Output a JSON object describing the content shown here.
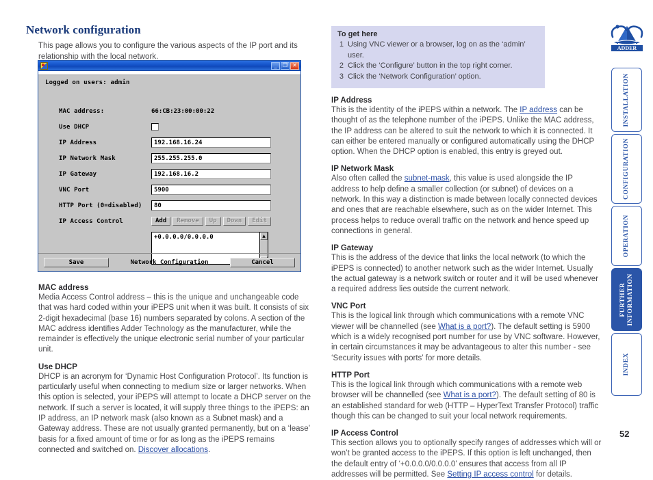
{
  "page": {
    "title": "Network configuration",
    "intro": "This page allows you to configure the various aspects of the IP port and its relationship with the local network.",
    "number": "52"
  },
  "dialog": {
    "window_icon": "vnc-icon",
    "minimize_glyph": "_",
    "maximize_glyph": "❐",
    "close_glyph": "✕",
    "logged_on": "Logged on users: admin",
    "fields": [
      {
        "label": "MAC address:",
        "type": "static",
        "value": "66:CB:23:00:00:22"
      },
      {
        "label": "Use DHCP",
        "type": "checkbox",
        "value": ""
      },
      {
        "label": "IP Address",
        "type": "text",
        "value": "192.168.16.24"
      },
      {
        "label": "IP Network Mask",
        "type": "text",
        "value": "255.255.255.0"
      },
      {
        "label": "IP Gateway",
        "type": "text",
        "value": "192.168.16.2"
      },
      {
        "label": "VNC Port",
        "type": "text",
        "value": "5900"
      },
      {
        "label": "HTTP Port (0=disabled)",
        "type": "text",
        "value": "80"
      }
    ],
    "access_control": {
      "label": "IP Access Control",
      "buttons": [
        {
          "label": "Add",
          "enabled": true
        },
        {
          "label": "Remove",
          "enabled": false
        },
        {
          "label": "Up",
          "enabled": false
        },
        {
          "label": "Down",
          "enabled": false
        },
        {
          "label": "Edit",
          "enabled": false
        }
      ],
      "list_entry": "+0.0.0.0/0.0.0.0",
      "scroll_up_glyph": "▲",
      "scroll_down_glyph": "▼"
    },
    "footer": {
      "save_label": "Save",
      "title": "Network Configuration",
      "cancel_label": "Cancel"
    }
  },
  "to_get_here": {
    "heading": "To get here",
    "steps": [
      {
        "num": "1",
        "text": "Using VNC viewer or a browser, log on as the ‘admin’ user."
      },
      {
        "num": "2",
        "text": "Click the ‘Configure’ button in the top right corner."
      },
      {
        "num": "3",
        "text": "Click the ‘Network Configuration’ option."
      }
    ]
  },
  "left_sections": [
    {
      "heading": "MAC address",
      "parts": [
        {
          "t": "Media Access Control address – this is the unique and unchangeable code that was hard coded within your iPEPS unit when it was built. It consists of six 2-digit hexadecimal (base 16) numbers separated by colons. A section of the MAC address identifies Adder Technology as the manufacturer, while the remainder is effectively the unique electronic serial number of your particular unit."
        }
      ]
    },
    {
      "heading": "Use DHCP",
      "parts": [
        {
          "t": "DHCP is an acronym for ‘Dynamic Host Configuration Protocol’. Its function is particularly useful when connecting to medium size or larger networks. When this option is selected, your iPEPS will attempt to locate a DHCP server on the network. If such a server is located, it will supply three things to the iPEPS: an IP address, an IP network mask (also known as a Subnet mask) and a Gateway address. These are not usually granted permanently, but on a ‘lease’ basis for a fixed amount of time or for as long as the iPEPS remains connected and switched on. "
        },
        {
          "t": "Discover allocations",
          "link": true
        },
        {
          "t": "."
        }
      ]
    }
  ],
  "right_sections": [
    {
      "heading": "IP Address",
      "parts": [
        {
          "t": "This is the identity of the iPEPS within a network. The "
        },
        {
          "t": "IP address",
          "link": true
        },
        {
          "t": " can be thought of as the telephone number of the iPEPS. Unlike the MAC address, the IP address can be altered to suit the network to which it is connected. It can either be entered manually or configured automatically using the DHCP option. When the DHCP option is enabled, this entry is greyed out."
        }
      ]
    },
    {
      "heading": "IP Network Mask",
      "parts": [
        {
          "t": "Also often called the "
        },
        {
          "t": "subnet-mask",
          "link": true
        },
        {
          "t": ", this value is used alongside the IP address to help define a smaller collection (or subnet) of devices on a network. In this way a distinction is made between locally connected devices and ones that are reachable elsewhere, such as on the wider Internet. This process helps to reduce overall traffic on the network and hence speed up connections in general."
        }
      ]
    },
    {
      "heading": "IP Gateway",
      "parts": [
        {
          "t": "This is the address of the device that links the local network (to which the iPEPS is connected) to another network such as the wider Internet. Usually the actual gateway is a network switch or router and it will be used whenever a required address lies outside the current network."
        }
      ]
    },
    {
      "heading": "VNC Port",
      "parts": [
        {
          "t": "This is the logical link through which communications with a remote VNC viewer will be channelled (see "
        },
        {
          "t": "What is a port?",
          "link": true
        },
        {
          "t": "). The default setting is 5900 which is a widely recognised port number for use by VNC software. However, in certain circumstances it may be advantageous to alter this number - see ‘Security issues with ports’ for more details."
        }
      ]
    },
    {
      "heading": "HTTP Port",
      "parts": [
        {
          "t": "This is the logical link through which communications with a remote web browser will be channelled (see "
        },
        {
          "t": "What is a port?",
          "link": true
        },
        {
          "t": "). The default setting of 80 is an established standard for web (HTTP – HyperText Transfer Protocol) traffic though this can be changed to suit your local network requirements."
        }
      ]
    },
    {
      "heading": "IP Access Control",
      "parts": [
        {
          "t": "This section allows you to optionally specify ranges of addresses which will or won’t be granted access to the iPEPS. If this option is left unchanged, then the default entry of ‘+0.0.0.0/0.0.0.0’ ensures that access from all IP addresses will be permitted. See "
        },
        {
          "t": "Setting IP access control",
          "link": true
        },
        {
          "t": " for details."
        }
      ]
    }
  ],
  "sidebar": {
    "brand": "ADDER",
    "tabs": [
      {
        "label": "INSTALLATION",
        "active": false,
        "height": 94
      },
      {
        "label": "CONFIGURATION",
        "active": false,
        "height": 102
      },
      {
        "label": "OPERATION",
        "active": false,
        "height": 88
      },
      {
        "label": "FURTHER\nINFORMATION",
        "active": true,
        "height": 92
      },
      {
        "label": "INDEX",
        "active": false,
        "height": 92
      }
    ]
  }
}
